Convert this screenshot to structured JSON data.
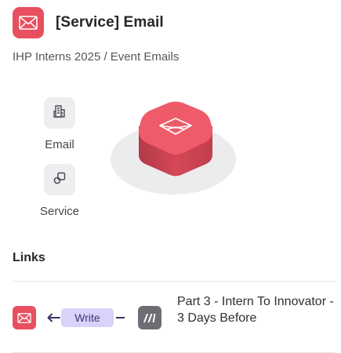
{
  "header": {
    "title": "[Service] Email",
    "icon": "envelope-icon",
    "icon_color": "#e8505f"
  },
  "breadcrumb": "IHP Interns 2025 / Event Emails",
  "tags": [
    {
      "label": "Email",
      "icon": "building-icon"
    },
    {
      "label": "Service",
      "icon": "link-squares-icon"
    }
  ],
  "illustration": {
    "icon": "envelope-icon",
    "color": "#e8505f"
  },
  "links": {
    "title": "Links",
    "items": [
      {
        "source_icon": "envelope-icon",
        "relation": "Write",
        "target_icon": "make-logo-icon",
        "target_label": "Part 3 - Intern To Innovator - 3 Days Before"
      }
    ]
  },
  "colors": {
    "accent_red": "#e8505f",
    "relation_pill": "#d9d2fb",
    "relation_text": "#3e3672",
    "neutral_icon": "#6d6d73"
  }
}
